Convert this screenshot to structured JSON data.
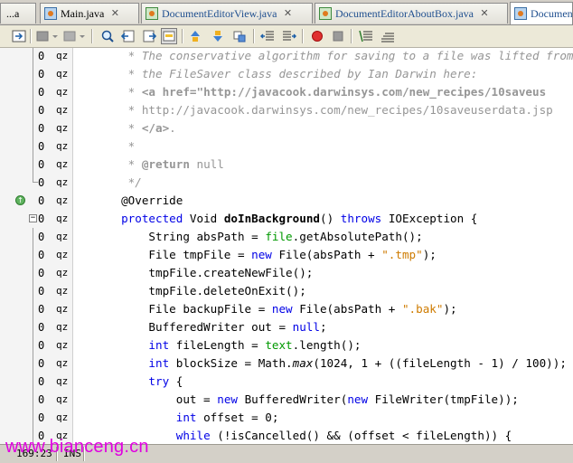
{
  "tabs": [
    {
      "label": "...a",
      "active": false
    },
    {
      "label": "Main.java",
      "active": false
    },
    {
      "label": "DocumentEditorView.java",
      "active": false
    },
    {
      "label": "DocumentEditorAboutBox.java",
      "active": false
    },
    {
      "label": "Documen",
      "active": true
    }
  ],
  "toolbar": {
    "icons": [
      "last-edit-icon",
      "back-icon",
      "back-dropdown-icon",
      "forward-icon",
      "forward-dropdown-icon",
      "find-icon",
      "find-previous-icon",
      "find-next-icon",
      "toggle-highlight-icon",
      "previous-bookmark-icon",
      "next-bookmark-icon",
      "toggle-bookmark-icon",
      "shift-left-icon",
      "shift-right-icon",
      "start-macro-icon",
      "stop-macro-icon",
      "comment-icon",
      "uncomment-icon"
    ]
  },
  "gutter": {
    "lines": [
      {
        "rev": "0",
        "author": "qz"
      },
      {
        "rev": "0",
        "author": "qz"
      },
      {
        "rev": "0",
        "author": "qz"
      },
      {
        "rev": "0",
        "author": "qz"
      },
      {
        "rev": "0",
        "author": "qz"
      },
      {
        "rev": "0",
        "author": "qz"
      },
      {
        "rev": "0",
        "author": "qz"
      },
      {
        "rev": "0",
        "author": "qz"
      },
      {
        "rev": "0",
        "author": "qz"
      },
      {
        "rev": "0",
        "author": "qz"
      },
      {
        "rev": "0",
        "author": "qz"
      },
      {
        "rev": "0",
        "author": "qz"
      },
      {
        "rev": "0",
        "author": "qz"
      },
      {
        "rev": "0",
        "author": "qz"
      },
      {
        "rev": "0",
        "author": "qz"
      },
      {
        "rev": "0",
        "author": "qz"
      },
      {
        "rev": "0",
        "author": "qz"
      },
      {
        "rev": "0",
        "author": "qz"
      },
      {
        "rev": "0",
        "author": "qz"
      },
      {
        "rev": "0",
        "author": "qz"
      },
      {
        "rev": "0",
        "author": "qz"
      },
      {
        "rev": "0",
        "author": "qz"
      }
    ]
  },
  "code": {
    "lines": [
      {
        "segs": [
          [
            "        * The conservative algorithm for saving to a file was lifted from",
            "cm ital"
          ]
        ]
      },
      {
        "segs": [
          [
            "        * the FileSaver class described by Ian Darwin here:",
            "cm ital"
          ]
        ]
      },
      {
        "segs": [
          [
            "        * ",
            "cm ital"
          ],
          [
            "<a href=\"http://javacook.darwinsys.com/new_recipes/10saveus",
            "cm bold"
          ]
        ]
      },
      {
        "segs": [
          [
            "        * http://javacook.darwinsys.com/new_recipes/10saveuserdata.jsp",
            "cm"
          ]
        ]
      },
      {
        "segs": [
          [
            "        * ",
            "cm ital"
          ],
          [
            "</a>",
            "cm bold"
          ],
          [
            ".",
            "cm"
          ]
        ]
      },
      {
        "segs": [
          [
            "        *",
            "cm ital"
          ]
        ]
      },
      {
        "segs": [
          [
            "        * ",
            "cm ital"
          ],
          [
            "@return",
            "tag"
          ],
          [
            " null",
            "cm"
          ]
        ]
      },
      {
        "segs": [
          [
            "        */",
            "cm ital"
          ]
        ]
      },
      {
        "segs": [
          [
            "       @Override",
            "ann"
          ]
        ]
      },
      {
        "segs": [
          [
            "       ",
            ""
          ],
          [
            "protected",
            "kw"
          ],
          [
            " Void ",
            ""
          ],
          [
            "doInBackground",
            "bold"
          ],
          [
            "() ",
            ""
          ],
          [
            "throws",
            "kw"
          ],
          [
            " IOException {",
            ""
          ]
        ]
      },
      {
        "segs": [
          [
            "           String absPath = ",
            ""
          ],
          [
            "file",
            "fld"
          ],
          [
            ".getAbsolutePath();",
            ""
          ]
        ]
      },
      {
        "segs": [
          [
            "           File tmpFile = ",
            ""
          ],
          [
            "new",
            "kw"
          ],
          [
            " File(absPath + ",
            ""
          ],
          [
            "\".tmp\"",
            "str"
          ],
          [
            ");",
            ""
          ]
        ]
      },
      {
        "segs": [
          [
            "           tmpFile.createNewFile();",
            ""
          ]
        ]
      },
      {
        "segs": [
          [
            "           tmpFile.deleteOnExit();",
            ""
          ]
        ]
      },
      {
        "segs": [
          [
            "           File backupFile = ",
            ""
          ],
          [
            "new",
            "kw"
          ],
          [
            " File(absPath + ",
            ""
          ],
          [
            "\".bak\"",
            "str"
          ],
          [
            ");",
            ""
          ]
        ]
      },
      {
        "segs": [
          [
            "           BufferedWriter out = ",
            ""
          ],
          [
            "null",
            "kw"
          ],
          [
            ";",
            ""
          ]
        ]
      },
      {
        "segs": [
          [
            "           ",
            ""
          ],
          [
            "int",
            "kw"
          ],
          [
            " fileLength = ",
            ""
          ],
          [
            "text",
            "fld"
          ],
          [
            ".length();",
            ""
          ]
        ]
      },
      {
        "segs": [
          [
            "           ",
            ""
          ],
          [
            "int",
            "kw"
          ],
          [
            " blockSize = Math.",
            ""
          ],
          [
            "max",
            "ital"
          ],
          [
            "(1024, 1 + ((fileLength - 1) / 100));",
            ""
          ]
        ]
      },
      {
        "segs": [
          [
            "           ",
            ""
          ],
          [
            "try",
            "kw"
          ],
          [
            " {",
            ""
          ]
        ]
      },
      {
        "segs": [
          [
            "               out = ",
            ""
          ],
          [
            "new",
            "kw"
          ],
          [
            " BufferedWriter(",
            ""
          ],
          [
            "new",
            "kw"
          ],
          [
            " FileWriter(tmpFile));",
            ""
          ]
        ]
      },
      {
        "segs": [
          [
            "               ",
            ""
          ],
          [
            "int",
            "kw"
          ],
          [
            " offset = 0;",
            ""
          ]
        ]
      },
      {
        "segs": [
          [
            "               ",
            ""
          ],
          [
            "while",
            "kw"
          ],
          [
            " (!isCancelled() && (offset < fileLength)) {",
            ""
          ]
        ]
      }
    ]
  },
  "status": {
    "position": "169:23",
    "mode": "INS"
  },
  "watermark": "www.bianceng.cn",
  "colors": {
    "keyword": "#0000e6",
    "comment": "#969696",
    "string": "#ce7b00",
    "field": "#009900",
    "watermark": "#e000e0"
  }
}
